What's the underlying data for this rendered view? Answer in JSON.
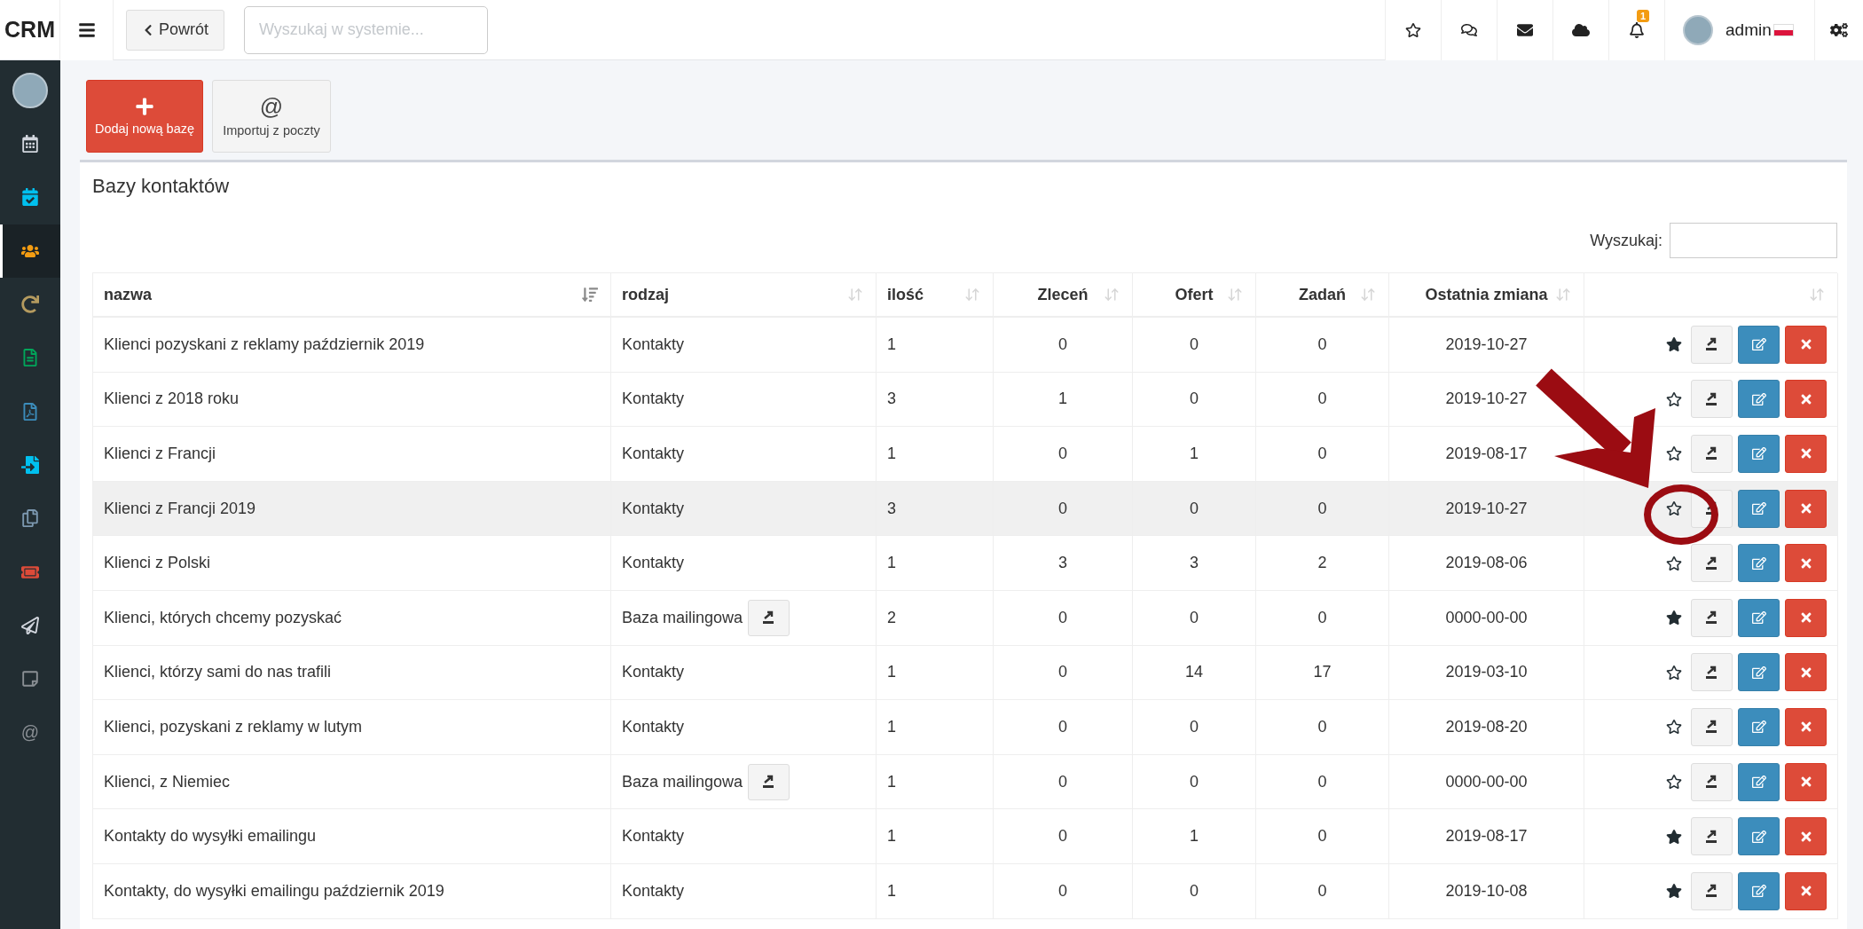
{
  "topbar": {
    "logo": "CRM",
    "back_button": "Powrót",
    "search": {
      "placeholder": "Wyszukaj w systemie..."
    },
    "notification_count": "1",
    "user": "admin"
  },
  "sidebar": {
    "items": [
      {
        "kind": "calendar",
        "color": "#d2d6de",
        "selected": false
      },
      {
        "kind": "calendar-check",
        "color": "#00c0ef",
        "selected": false
      },
      {
        "kind": "users",
        "color": "#f39c12",
        "selected": true
      },
      {
        "kind": "refresh",
        "color": "#b59b5f",
        "selected": false
      },
      {
        "kind": "document",
        "color": "#00a65a",
        "selected": false
      },
      {
        "kind": "pdf",
        "color": "#3c8dbc",
        "selected": false
      },
      {
        "kind": "import",
        "color": "#00c0ef",
        "selected": false
      },
      {
        "kind": "copy",
        "color": "#7c98b0",
        "selected": false
      },
      {
        "kind": "ticket",
        "color": "#dd4b39",
        "selected": false
      },
      {
        "kind": "send",
        "color": "#d2d6de",
        "selected": false
      },
      {
        "kind": "note",
        "color": "#8a8f94",
        "selected": false
      },
      {
        "kind": "at",
        "color": "#8a8f94",
        "selected": false,
        "glyph": "@"
      }
    ]
  },
  "toolbar": [
    {
      "kind": "add",
      "label": "Dodaj nową bazę"
    },
    {
      "kind": "mail",
      "label": "Importuj z poczty",
      "glyph": "@"
    }
  ],
  "panel": {
    "title": "Bazy kontaktów",
    "search_label": "Wyszukaj:"
  },
  "table": {
    "columns": [
      {
        "label": "nazwa",
        "sorted": true
      },
      {
        "label": "rodzaj",
        "sorted": false
      },
      {
        "label": "ilość",
        "sorted": false
      },
      {
        "label": "Zleceń",
        "sorted": false
      },
      {
        "label": "Ofert",
        "sorted": false
      },
      {
        "label": "Zadań",
        "sorted": false
      },
      {
        "label": "Ostatnia zmiana",
        "sorted": false
      },
      {
        "sorted": false
      }
    ],
    "rows": [
      {
        "name": "Klienci pozyskani z reklamy październik 2019",
        "type": "Kontakty",
        "kind": "contacts",
        "count": "1",
        "orders": "0",
        "offers": "0",
        "tasks": "0",
        "changed": "2019-10-27",
        "favorite": true,
        "highlighted": false
      },
      {
        "name": "Klienci z 2018 roku",
        "type": "Kontakty",
        "kind": "contacts",
        "count": "3",
        "orders": "1",
        "offers": "0",
        "tasks": "0",
        "changed": "2019-10-27",
        "favorite": false,
        "highlighted": false
      },
      {
        "name": "Klienci z Francji",
        "type": "Kontakty",
        "kind": "contacts",
        "count": "1",
        "orders": "0",
        "offers": "1",
        "tasks": "0",
        "changed": "2019-08-17",
        "favorite": false,
        "highlighted": false
      },
      {
        "name": "Klienci z Francji 2019",
        "type": "Kontakty",
        "kind": "contacts",
        "count": "3",
        "orders": "0",
        "offers": "0",
        "tasks": "0",
        "changed": "2019-10-27",
        "favorite": false,
        "highlighted": true
      },
      {
        "name": "Klienci z Polski",
        "type": "Kontakty",
        "kind": "contacts",
        "count": "1",
        "orders": "3",
        "offers": "3",
        "tasks": "2",
        "changed": "2019-08-06",
        "favorite": false,
        "highlighted": false
      },
      {
        "name": "Klienci, których chcemy pozyskać",
        "type": "Baza mailingowa",
        "kind": "mailing",
        "count": "2",
        "orders": "0",
        "offers": "0",
        "tasks": "0",
        "changed": "0000-00-00",
        "favorite": true,
        "highlighted": false
      },
      {
        "name": "Klienci, którzy sami do nas trafili",
        "type": "Kontakty",
        "kind": "contacts",
        "count": "1",
        "orders": "0",
        "offers": "14",
        "tasks": "17",
        "changed": "2019-03-10",
        "favorite": false,
        "highlighted": false
      },
      {
        "name": "Klienci, pozyskani z reklamy w lutym",
        "type": "Kontakty",
        "kind": "contacts",
        "count": "1",
        "orders": "0",
        "offers": "0",
        "tasks": "0",
        "changed": "2019-08-20",
        "favorite": false,
        "highlighted": false
      },
      {
        "name": "Klienci, z Niemiec",
        "type": "Baza mailingowa",
        "kind": "mailing",
        "count": "1",
        "orders": "0",
        "offers": "0",
        "tasks": "0",
        "changed": "0000-00-00",
        "favorite": false,
        "highlighted": false
      },
      {
        "name": "Kontakty do wysyłki emailingu",
        "type": "Kontakty",
        "kind": "contacts",
        "count": "1",
        "orders": "0",
        "offers": "1",
        "tasks": "0",
        "changed": "2019-08-17",
        "favorite": true,
        "highlighted": false
      },
      {
        "name": "Kontakty, do wysyłki emailingu październik 2019",
        "type": "Kontakty",
        "kind": "contacts",
        "count": "1",
        "orders": "0",
        "offers": "0",
        "tasks": "0",
        "changed": "2019-10-08",
        "favorite": true,
        "highlighted": false
      }
    ]
  }
}
